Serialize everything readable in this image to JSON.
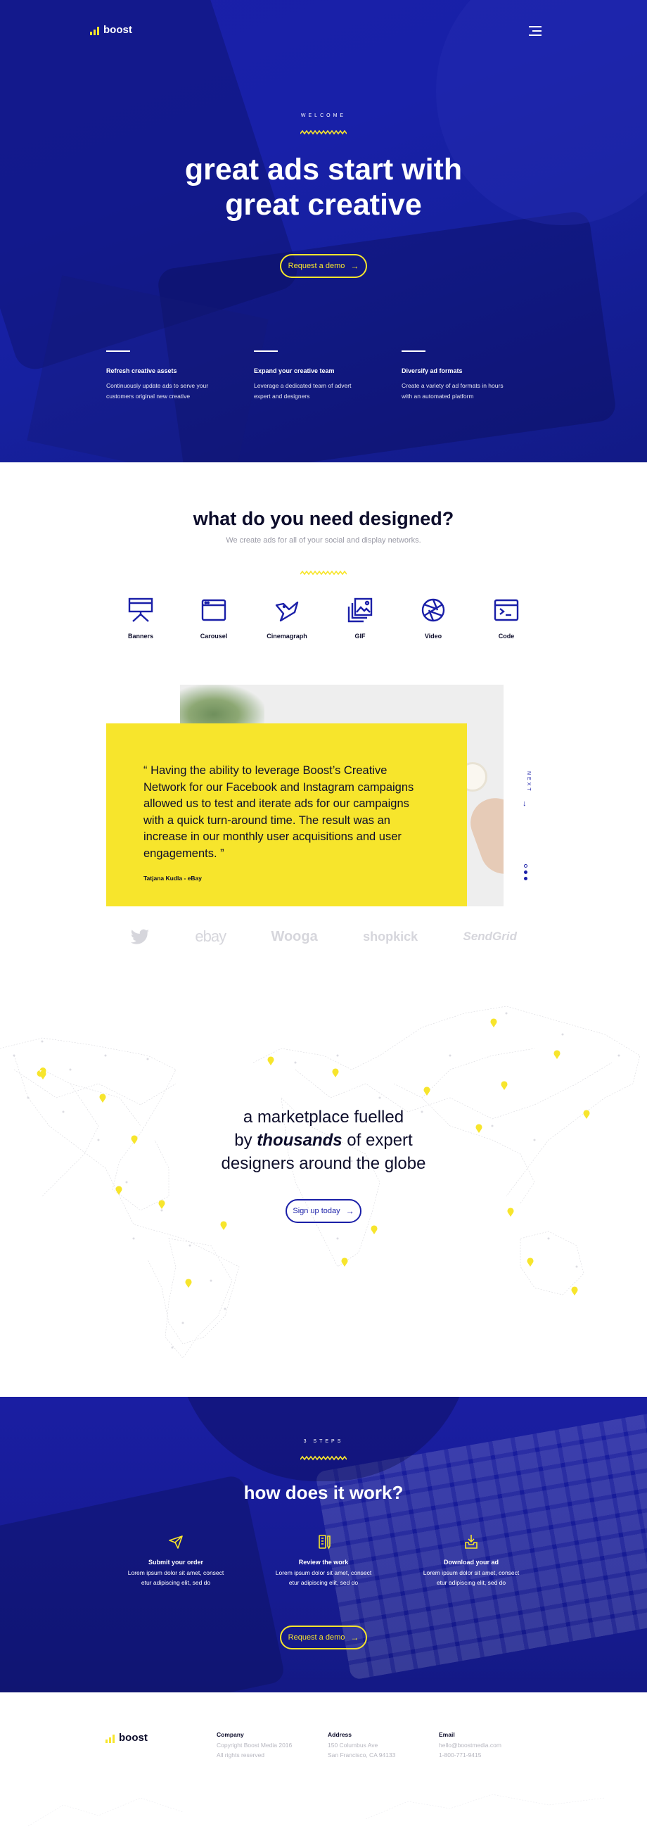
{
  "brand": {
    "name": "boost",
    "accent": "#f7e52c",
    "primary": "#1a1fa8"
  },
  "hero": {
    "eyebrow": "WELCOME",
    "title_line1": "great ads start with",
    "title_line2": "great creative",
    "cta": "Request a demo",
    "menu_icon": "hamburger-icon",
    "features": [
      {
        "title": "Refresh creative assets",
        "text_line1": "Continuously update ads to serve your",
        "text_line2": "customers original new creative"
      },
      {
        "title": "Expand your creative team",
        "text_line1": "Leverage a dedicated team of advert",
        "text_line2": "expert and designers"
      },
      {
        "title": "Diversify ad formats",
        "text_line1": "Create a variety of ad formats in hours",
        "text_line2": "with an automated platform"
      }
    ]
  },
  "designed": {
    "title": "what do you need designed?",
    "subtitle": "We create ads for all of your social and display networks.",
    "types": [
      {
        "label": "Banners",
        "icon": "presentation-board-icon"
      },
      {
        "label": "Carousel",
        "icon": "browser-window-icon"
      },
      {
        "label": "Cinemagraph",
        "icon": "bird-icon"
      },
      {
        "label": "GIF",
        "icon": "image-stack-icon"
      },
      {
        "label": "Video",
        "icon": "camera-aperture-icon"
      },
      {
        "label": "Code",
        "icon": "code-window-icon"
      }
    ]
  },
  "testimonial": {
    "quote": "“ Having the ability to leverage Boost’s Creative Network for our Facebook and Instagram campaigns allowed us to test and iterate ads for our campaigns with a quick turn-around time. The result was an increase in our monthly user acquisitions and user engagements. ”",
    "author": "Tatjana Kudla - eBay",
    "next_label": "NEXT",
    "slides_total": 3,
    "slide_active": 2
  },
  "brands": [
    "twitter",
    "ebay",
    "Wooga",
    "shopkick",
    "SendGrid"
  ],
  "marketplace": {
    "line1": "a marketplace fuelled",
    "line2_pre": "by ",
    "line2_bold": "thousands",
    "line2_post": " of expert",
    "line3": "designers around the globe",
    "cta": "Sign up today"
  },
  "steps": {
    "eyebrow": "3 STEPS",
    "title": "how does it work?",
    "items": [
      {
        "title": "Submit your order",
        "icon": "paper-plane-icon",
        "text_line1": "Lorem ipsum dolor sit amet, consect",
        "text_line2": "etur adipiscing elit, sed do"
      },
      {
        "title": "Review the work",
        "icon": "review-pencil-icon",
        "text_line1": "Lorem ipsum dolor sit amet, consect",
        "text_line2": "etur adipiscing elit, sed do"
      },
      {
        "title": "Download your ad",
        "icon": "download-tray-icon",
        "text_line1": "Lorem ipsum dolor sit amet, consect",
        "text_line2": "etur adipiscing elit, sed do"
      }
    ],
    "cta": "Request a demo"
  },
  "footer": {
    "company": {
      "title": "Company",
      "line1": "Copyright Boost Media 2016",
      "line2": "All rights reserved"
    },
    "address": {
      "title": "Address",
      "line1": "150 Columbus Ave",
      "line2": "San Francisco, CA 94133"
    },
    "email": {
      "title": "Email",
      "line1": "hello@boostmedia.com",
      "line2": "1-800-771-9415"
    }
  }
}
